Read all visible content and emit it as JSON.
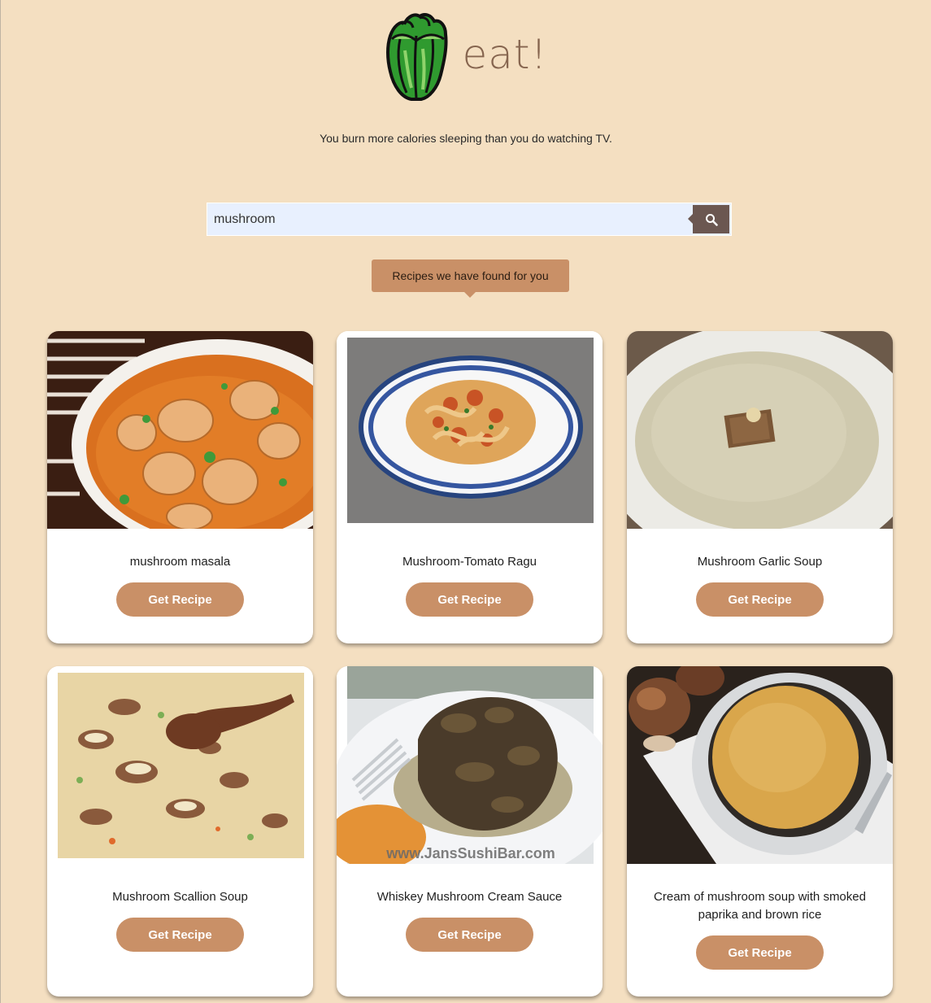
{
  "app": {
    "brand": "eat!",
    "tagline": "You burn more calories sleeping than you do watching TV."
  },
  "search": {
    "value": "mushroom",
    "button_icon": "search-icon"
  },
  "results_label": "Recipes we have found for you",
  "recipes": [
    {
      "title": "mushroom masala",
      "button": "Get Recipe"
    },
    {
      "title": "Mushroom-Tomato Ragu",
      "button": "Get Recipe"
    },
    {
      "title": "Mushroom Garlic Soup",
      "button": "Get Recipe"
    },
    {
      "title": "Mushroom Scallion Soup",
      "button": "Get Recipe"
    },
    {
      "title": "Whiskey Mushroom Cream Sauce",
      "button": "Get Recipe",
      "watermark": "www.JansSushiBar.com"
    },
    {
      "title": "Cream of mushroom soup with smoked paprika and brown rice",
      "button": "Get Recipe"
    }
  ],
  "colors": {
    "background": "#f4dfc1",
    "accent": "#c99067",
    "brand_text": "#86654f",
    "search_button": "#6b5751"
  }
}
